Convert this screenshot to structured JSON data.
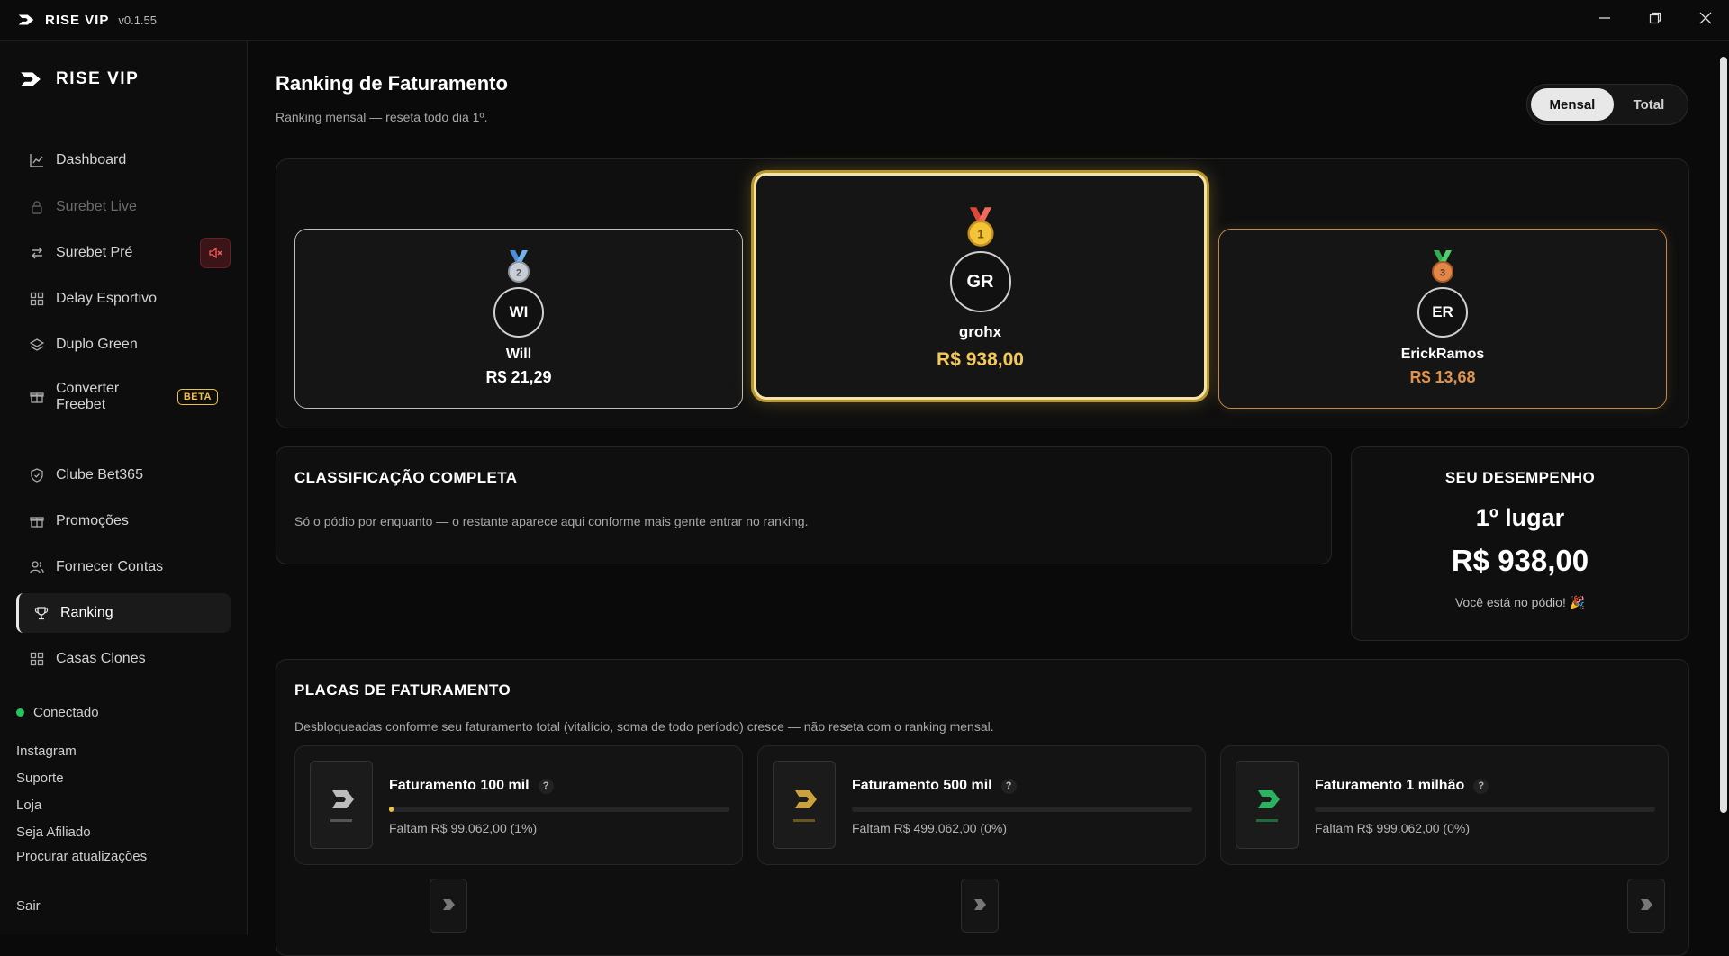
{
  "titlebar": {
    "app": "RISE VIP",
    "version": "v0.1.55"
  },
  "sidebar": {
    "brand": "RISE VIP",
    "items": [
      {
        "label": "Dashboard",
        "icon": "chart-line-icon"
      },
      {
        "label": "Surebet Live",
        "icon": "lock-icon"
      },
      {
        "label": "Surebet Pré",
        "icon": "swap-icon"
      },
      {
        "label": "Delay Esportivo",
        "icon": "grid-icon"
      },
      {
        "label": "Duplo Green",
        "icon": "layers-icon"
      },
      {
        "label": "Converter Freebet",
        "icon": "gift-icon",
        "badge": "BETA"
      },
      {
        "label": "Clube Bet365",
        "icon": "shield-icon"
      },
      {
        "label": "Promoções",
        "icon": "gift-icon"
      },
      {
        "label": "Fornecer Contas",
        "icon": "users-icon"
      },
      {
        "label": "Ranking",
        "icon": "trophy-icon"
      },
      {
        "label": "Casas Clones",
        "icon": "grid-icon"
      }
    ],
    "status": "Conectado",
    "links": [
      "Instagram",
      "Suporte",
      "Loja",
      "Seja Afiliado",
      "Procurar atualizações"
    ],
    "logout": "Sair"
  },
  "header": {
    "title": "Ranking de Faturamento",
    "subtitle": "Ranking mensal — reseta todo dia 1º.",
    "toggle": {
      "mensal": "Mensal",
      "total": "Total",
      "selected": "Mensal"
    }
  },
  "podium": {
    "first": {
      "initials": "GR",
      "name": "grohx",
      "value": "R$ 938,00",
      "medal": "1"
    },
    "second": {
      "initials": "WI",
      "name": "Will",
      "value": "R$ 21,29",
      "medal": "2"
    },
    "third": {
      "initials": "ER",
      "name": "ErickRamos",
      "value": "R$ 13,68",
      "medal": "3"
    }
  },
  "classification": {
    "title": "CLASSIFICAÇÃO COMPLETA",
    "text": "Só o pódio por enquanto — o restante aparece aqui conforme mais gente entrar no ranking."
  },
  "performance": {
    "title": "SEU DESEMPENHO",
    "place": "1º lugar",
    "value": "R$ 938,00",
    "message": "Você está no pódio! 🎉"
  },
  "plates": {
    "title": "PLACAS DE FATURAMENTO",
    "description": "Desbloqueadas conforme seu faturamento total (vitalício, soma de todo período) cresce — não reseta com o ranking mensal.",
    "items": [
      {
        "name": "Faturamento 100 mil",
        "missing": "Faltam R$ 99.062,00 (1%)",
        "progress": 0.01,
        "accent": "#d8d8d8"
      },
      {
        "name": "Faturamento 500 mil",
        "missing": "Faltam R$ 499.062,00 (0%)",
        "progress": 0.0,
        "accent": "#e0b040"
      },
      {
        "name": "Faturamento 1 milhão",
        "missing": "Faltam R$ 999.062,00 (0%)",
        "progress": 0.0,
        "accent": "#2fc46a"
      }
    ]
  },
  "colors": {
    "gold": "#f0c040",
    "bronze": "#e0934a",
    "online": "#22c55e",
    "danger": "#ff5a5a"
  }
}
